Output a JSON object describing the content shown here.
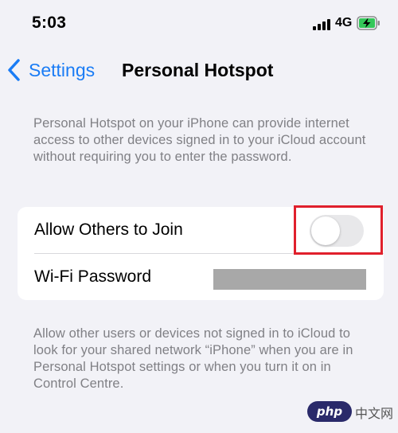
{
  "status_bar": {
    "time": "5:03",
    "network": "4G",
    "icons": [
      "cellular-signal-icon",
      "battery-charging-icon"
    ]
  },
  "nav": {
    "back_label": "Settings",
    "title": "Personal Hotspot",
    "accent_color": "#1a7cf5"
  },
  "main": {
    "description_top": "Personal Hotspot on your iPhone can provide internet access to other devices signed in to your iCloud account without requiring you to enter the password.",
    "rows": [
      {
        "label": "Allow Others to Join",
        "control": "toggle",
        "state": "off"
      },
      {
        "label": "Wi-Fi Password",
        "value": "[redacted]"
      }
    ],
    "description_bottom": "Allow other users or devices not signed in to iCloud to look for your shared network “iPhone” when you are in Personal Hotspot settings or when you turn it on in Control Centre.",
    "highlight_color": "#e0202c"
  },
  "watermark": {
    "php": "php",
    "text": "中文网"
  }
}
